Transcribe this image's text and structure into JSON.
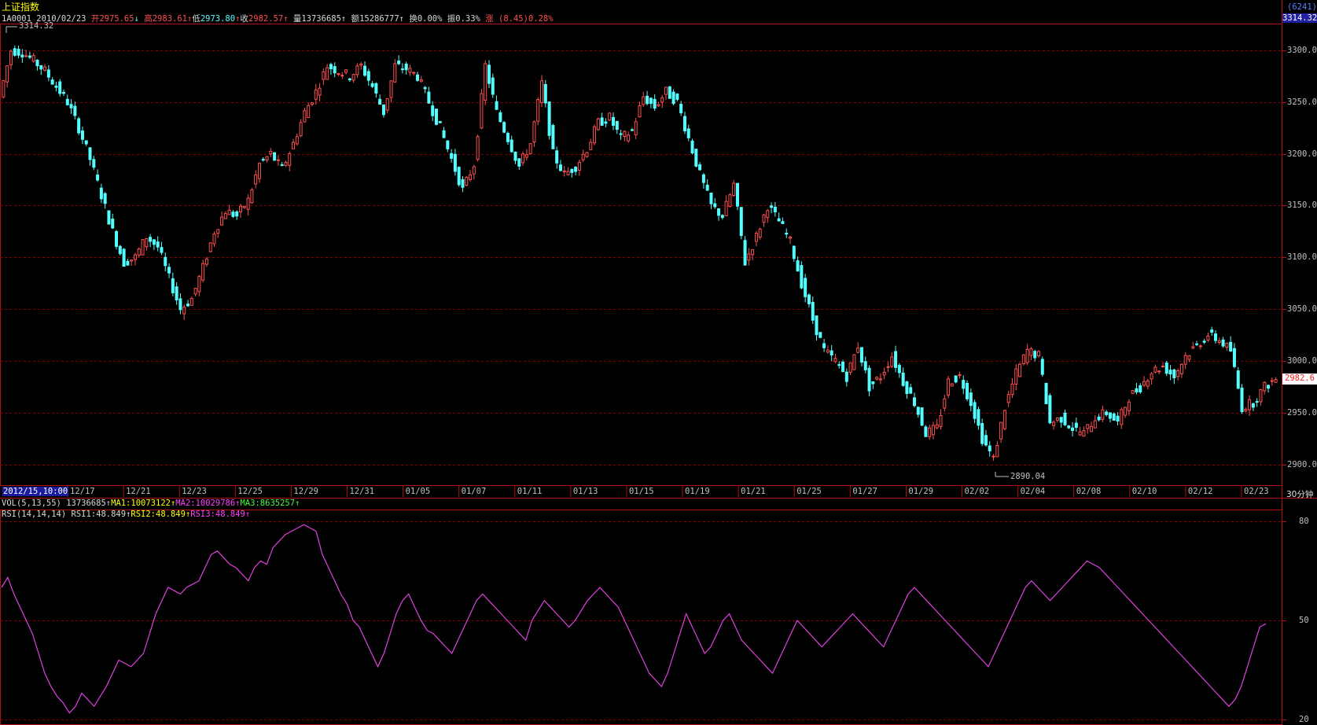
{
  "header": {
    "title": "上证指数",
    "code": "1A0001",
    "date": "2010/02/23",
    "open_label": "开",
    "open": "2975.65",
    "open_arrow": "↓",
    "high_label": "高",
    "high": "2983.61",
    "high_arrow": "↑",
    "low_label": "低",
    "low": "2973.80",
    "low_arrow": "↑",
    "close_label": "收",
    "close": "2982.57",
    "close_arrow": "↑",
    "volume_label": "量",
    "volume": "13736685",
    "volume_arrow": "↑",
    "amount_label": "额",
    "amount": "15286777",
    "amount_arrow": "↑",
    "turnover_label": "换",
    "turnover": "0.00%",
    "amplitude_label": "振",
    "amplitude": "0.33%",
    "change_label": "涨",
    "change": "(8.45)0.28%"
  },
  "right_panel": {
    "count": "(6241)",
    "top_value": "3314.32",
    "current_price": "2982.6",
    "period": "30分钟"
  },
  "annotations": {
    "max_label": "3314.32",
    "min_label": "2890.04"
  },
  "crosshair_date": "2012/15,10:00",
  "vol_line": {
    "name": "VOL(5,13,55)",
    "value": "13736685",
    "value_arrow": "↑",
    "ma1_label": "MA1:",
    "ma1": "10073122",
    "ma1_arrow": "↑",
    "ma2_label": "MA2:",
    "ma2": "10029786",
    "ma2_arrow": "↑",
    "ma3_label": "MA3:",
    "ma3": "8635257",
    "ma3_arrow": "↑"
  },
  "rsi_line": {
    "name": "RSI(14,14,14)",
    "rsi1_label": "RSI1:",
    "rsi1": "48.849",
    "rsi1_arrow": "↑",
    "rsi2_label": "RSI2:",
    "rsi2": "48.849",
    "rsi2_arrow": "↑",
    "rsi3_label": "RSI3:",
    "rsi3": "48.849",
    "rsi3_arrow": "↑"
  },
  "colors": {
    "background": "#000000",
    "up_candle": "#ff5050",
    "down_candle": "#54ffff",
    "grid": "#8b0000",
    "frame": "#b01010",
    "rsi": "#e040e0"
  },
  "chart_data": [
    {
      "type": "candlestick",
      "title": "上证指数",
      "interval": "30分钟",
      "ylim": [
        2880,
        3325
      ],
      "yticks": [
        2900.0,
        2950.0,
        3000.0,
        3050.0,
        3100.0,
        3150.0,
        3200.0,
        3250.0,
        3300.0
      ],
      "ytick_labels": [
        "2900.0",
        "2950.0",
        "3000.0",
        "3050.0",
        "3100.0",
        "3150.0",
        "3200.0",
        "3250.0",
        "3300.0"
      ],
      "xtick_labels": [
        "12/17",
        "12/21",
        "12/23",
        "12/25",
        "12/29",
        "12/31",
        "01/05",
        "01/07",
        "01/11",
        "01/13",
        "01/15",
        "01/19",
        "01/21",
        "01/25",
        "01/27",
        "01/29",
        "02/02",
        "02/04",
        "02/08",
        "02/10",
        "02/12",
        "02/23"
      ],
      "grid": true,
      "high": 3314.32,
      "low": 2890.04,
      "last_close": 2982.57,
      "close_path": [
        3255,
        3300,
        3298,
        3290,
        3280,
        3265,
        3250,
        3225,
        3195,
        3160,
        3125,
        3095,
        3100,
        3120,
        3110,
        3080,
        3050,
        3060,
        3090,
        3125,
        3145,
        3140,
        3155,
        3190,
        3200,
        3185,
        3210,
        3240,
        3260,
        3285,
        3280,
        3275,
        3285,
        3265,
        3240,
        3285,
        3282,
        3275,
        3250,
        3225,
        3195,
        3165,
        3190,
        3285,
        3240,
        3215,
        3188,
        3210,
        3268,
        3200,
        3180,
        3188,
        3205,
        3230,
        3235,
        3215,
        3222,
        3255,
        3245,
        3260,
        3250,
        3215,
        3180,
        3150,
        3140,
        3170,
        3095,
        3120,
        3150,
        3135,
        3115,
        3075,
        3040,
        3010,
        3000,
        2985,
        3015,
        2975,
        2985,
        3005,
        2980,
        2960,
        2930,
        2935,
        2980,
        2985,
        2960,
        2925,
        2905,
        2955,
        2988,
        3010,
        3005,
        2940,
        2945,
        2935,
        2930,
        2945,
        2950,
        2940,
        2965,
        2975,
        2990,
        2995,
        2985,
        3005,
        3015,
        3025,
        3020,
        3010,
        2955,
        2960,
        2975
      ]
    },
    {
      "type": "line",
      "title": "RSI(14,14,14)",
      "ylim": [
        20,
        80
      ],
      "yticks": [
        20,
        50,
        80
      ],
      "ytick_labels": [
        "20",
        "50",
        "80"
      ],
      "series": [
        {
          "name": "RSI1",
          "values": [
            60,
            63,
            58,
            54,
            50,
            46,
            40,
            34,
            30,
            27,
            25,
            22,
            24,
            28,
            26,
            24,
            27,
            30,
            34,
            38,
            37,
            36,
            38,
            40,
            46,
            52,
            56,
            60,
            59,
            58,
            60,
            61,
            62,
            66,
            70,
            71,
            69,
            67,
            66,
            64,
            62,
            66,
            68,
            67,
            72,
            74,
            76,
            77,
            78,
            79,
            78,
            77,
            70,
            66,
            62,
            58,
            55,
            50,
            48,
            44,
            40,
            36,
            40,
            46,
            52,
            56,
            58,
            54,
            50,
            47,
            46,
            44,
            42,
            40,
            44,
            48,
            52,
            56,
            58,
            56,
            54,
            52,
            50,
            48,
            46,
            44,
            50,
            53,
            56,
            54,
            52,
            50,
            48,
            50,
            53,
            56,
            58,
            60,
            58,
            56,
            54,
            50,
            46,
            42,
            38,
            34,
            32,
            30,
            34,
            40,
            46,
            52,
            48,
            44,
            40,
            42,
            46,
            50,
            52,
            48,
            44,
            42,
            40,
            38,
            36,
            34,
            38,
            42,
            46,
            50,
            48,
            46,
            44,
            42,
            44,
            46,
            48,
            50,
            52,
            50,
            48,
            46,
            44,
            42,
            46,
            50,
            54,
            58,
            60,
            58,
            56,
            54,
            52,
            50,
            48,
            46,
            44,
            42,
            40,
            38,
            36,
            40,
            44,
            48,
            52,
            56,
            60,
            62,
            60,
            58,
            56,
            58,
            60,
            62,
            64,
            66,
            68,
            67,
            66,
            64,
            62,
            60,
            58,
            56,
            54,
            52,
            50,
            48,
            46,
            44,
            42,
            40,
            38,
            36,
            34,
            32,
            30,
            28,
            26,
            24,
            26,
            30,
            36,
            42,
            48,
            49
          ]
        }
      ]
    }
  ]
}
